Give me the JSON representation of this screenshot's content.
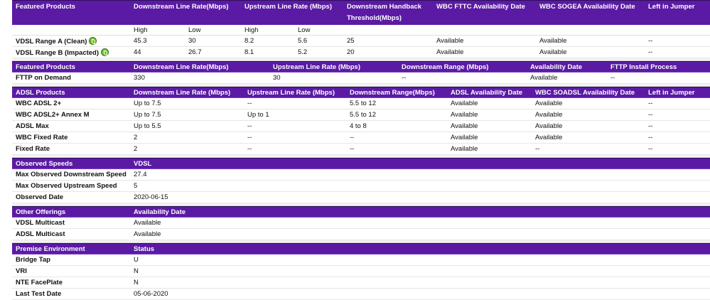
{
  "vdsl": {
    "headers": {
      "products": "Featured Products",
      "down": "Downstream Line Rate(Mbps)",
      "up": "Upstream Line Rate (Mbps)",
      "handback1": "Downstream Handback",
      "handback2": "Threshold(Mbps)",
      "fttc": "WBC FTTC Availability Date",
      "sogea": "WBC SOGEA Availability Date",
      "jumper": "Left in Jumper"
    },
    "sub": {
      "high1": "High",
      "low1": "Low",
      "high2": "High",
      "low2": "Low"
    },
    "rows": [
      {
        "name": "VDSL Range A (Clean)",
        "dh": "45.3",
        "dl": "30",
        "uh": "8.2",
        "ul": "5.6",
        "hb": "25",
        "fttc": "Available",
        "sogea": "Available",
        "jumper": "--"
      },
      {
        "name": "VDSL Range B (Impacted)",
        "dh": "44",
        "dl": "26.7",
        "uh": "8.1",
        "ul": "5.2",
        "hb": "20",
        "fttc": "Available",
        "sogea": "Available",
        "jumper": "--"
      }
    ]
  },
  "fttp": {
    "headers": {
      "products": "Featured Products",
      "down": "Downstream Line Rate(Mbps)",
      "up": "Upstream Line Rate (Mbps)",
      "range": "Downstream Range (Mbps)",
      "avail": "Availability Date",
      "install": "FTTP Install Process"
    },
    "rows": [
      {
        "name": "FTTP on Demand",
        "down": "330",
        "up": "30",
        "range": "--",
        "avail": "Available",
        "install": "--"
      }
    ]
  },
  "adsl": {
    "headers": {
      "products": "ADSL Products",
      "down": "Downstream Line Rate (Mbps)",
      "up": "Upstream Line Rate (Mbps)",
      "range": "Downstream Range(Mbps)",
      "avail": "ADSL Availability Date",
      "soadsl": "WBC SOADSL Availability Date",
      "jumper": "Left in Jumper"
    },
    "rows": [
      {
        "name": "WBC ADSL 2+",
        "down": "Up to 7.5",
        "up": "--",
        "range": "5.5 to 12",
        "avail": "Available",
        "soadsl": "Available",
        "jumper": "--"
      },
      {
        "name": "WBC ADSL2+ Annex M",
        "down": "Up to 7.5",
        "up": "Up to 1",
        "range": "5.5 to 12",
        "avail": "Available",
        "soadsl": "Available",
        "jumper": "--"
      },
      {
        "name": "ADSL Max",
        "down": "Up to 5.5",
        "up": "--",
        "range": "4 to 8",
        "avail": "Available",
        "soadsl": "Available",
        "jumper": "--"
      },
      {
        "name": "WBC Fixed Rate",
        "down": "2",
        "up": "--",
        "range": "--",
        "avail": "Available",
        "soadsl": "Available",
        "jumper": "--"
      },
      {
        "name": "Fixed Rate",
        "down": "2",
        "up": "--",
        "range": "--",
        "avail": "Available",
        "soadsl": "--",
        "jumper": "--"
      }
    ]
  },
  "observed": {
    "headers": {
      "label": "Observed Speeds",
      "value": "VDSL"
    },
    "rows": [
      {
        "label": "Max Observed Downstream Speed",
        "value": "27.4"
      },
      {
        "label": "Max Observed Upstream Speed",
        "value": "5"
      },
      {
        "label": "Observed Date",
        "value": "2020-06-15"
      }
    ]
  },
  "other": {
    "headers": {
      "label": "Other Offerings",
      "value": "Availability Date"
    },
    "rows": [
      {
        "label": "VDSL Multicast",
        "value": "Available"
      },
      {
        "label": "ADSL Multicast",
        "value": "Available"
      }
    ]
  },
  "premise": {
    "headers": {
      "label": "Premise Environment",
      "value": "Status"
    },
    "rows": [
      {
        "label": "Bridge Tap",
        "value": "U"
      },
      {
        "label": "VRI",
        "value": "N"
      },
      {
        "label": "NTE FacePlate",
        "value": "N"
      },
      {
        "label": "Last Test Date",
        "value": "05-06-2020"
      }
    ]
  },
  "colors": {
    "header_bg": "#5b1aa4",
    "icon_green": "#6fbf2a"
  },
  "icons": {
    "status": "leaf-check-icon"
  }
}
